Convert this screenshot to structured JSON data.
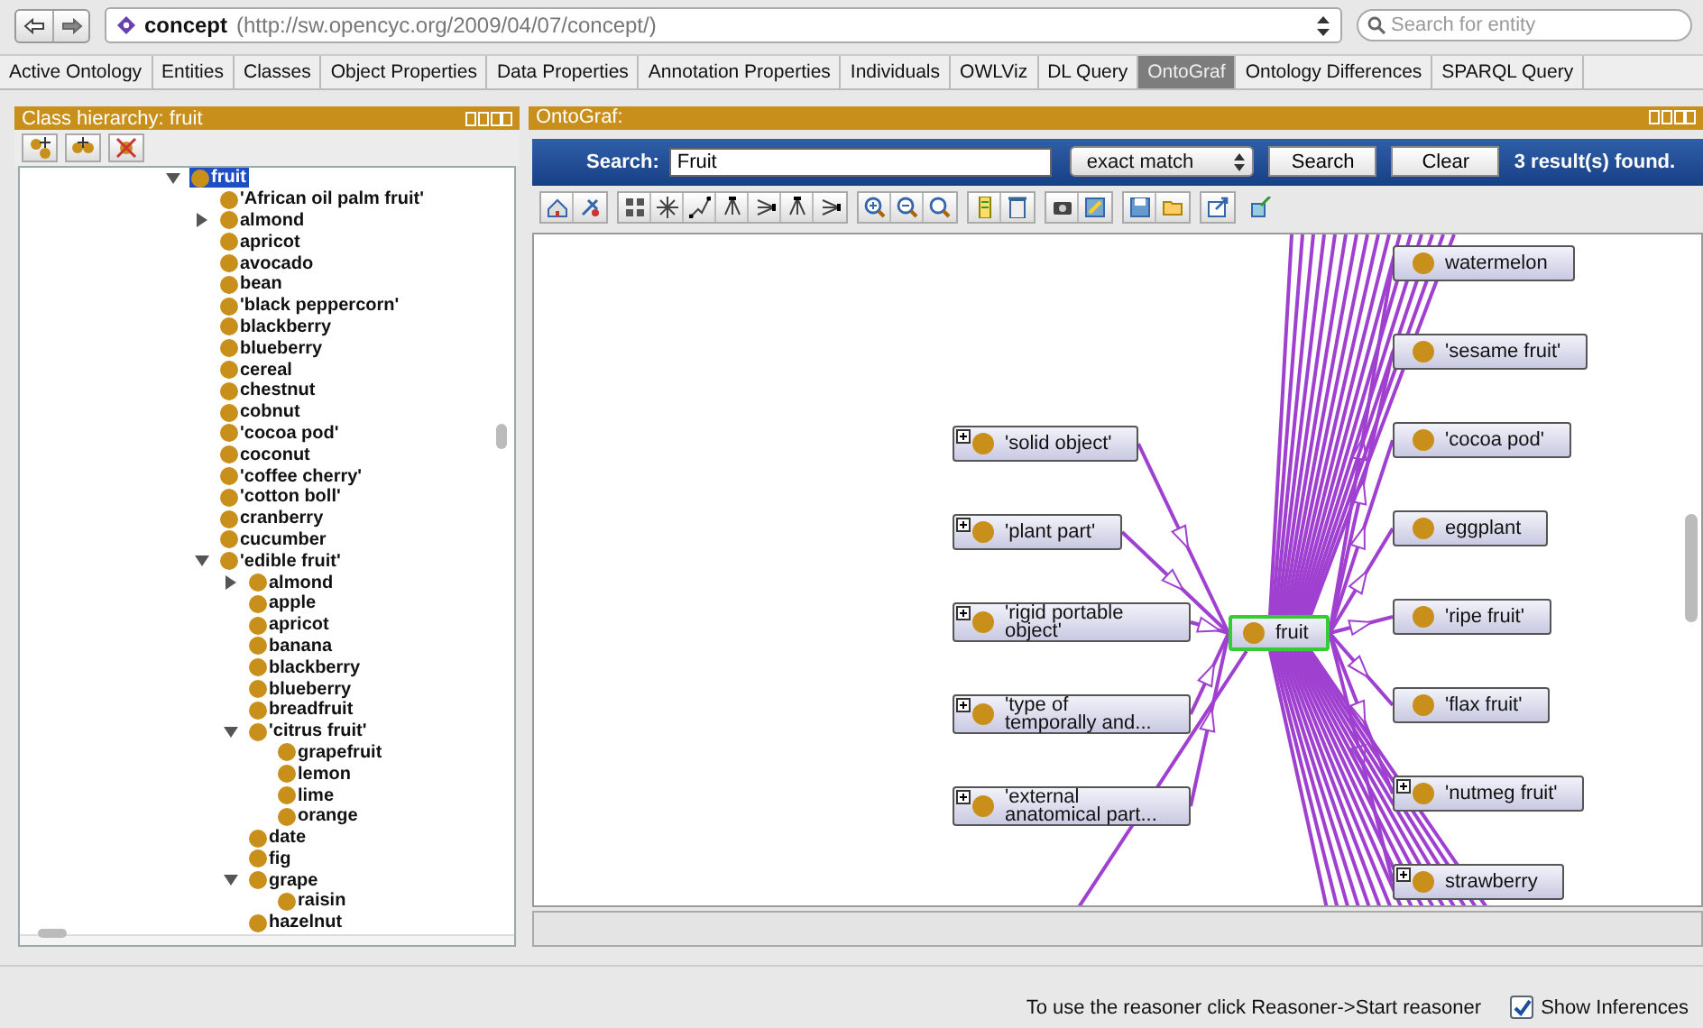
{
  "address_bar": {
    "entity": "concept",
    "uri": "(http://sw.opencyc.org/2009/04/07/concept/)",
    "search_placeholder": "Search for entity"
  },
  "tabs": [
    {
      "label": "Active Ontology",
      "selected": false
    },
    {
      "label": "Entities",
      "selected": false
    },
    {
      "label": "Classes",
      "selected": false
    },
    {
      "label": "Object Properties",
      "selected": false
    },
    {
      "label": "Data Properties",
      "selected": false
    },
    {
      "label": "Annotation Properties",
      "selected": false
    },
    {
      "label": "Individuals",
      "selected": false
    },
    {
      "label": "OWLViz",
      "selected": false
    },
    {
      "label": "DL Query",
      "selected": false
    },
    {
      "label": "OntoGraf",
      "selected": true
    },
    {
      "label": "Ontology Differences",
      "selected": false
    },
    {
      "label": "SPARQL Query",
      "selected": false
    }
  ],
  "class_hierarchy": {
    "title": "Class hierarchy: fruit",
    "tree": [
      {
        "label": "fruit",
        "expanded": true,
        "selected": true,
        "children": [
          {
            "label": "'African oil palm fruit'",
            "selected": false
          },
          {
            "label": "almond",
            "expanded": false,
            "selected": false
          },
          {
            "label": "apricot",
            "selected": false
          },
          {
            "label": "avocado",
            "selected": false
          },
          {
            "label": "bean",
            "selected": false
          },
          {
            "label": "'black peppercorn'",
            "selected": false
          },
          {
            "label": "blackberry",
            "selected": false
          },
          {
            "label": "blueberry",
            "selected": false
          },
          {
            "label": "cereal",
            "selected": false
          },
          {
            "label": "chestnut",
            "selected": false
          },
          {
            "label": "cobnut",
            "selected": false
          },
          {
            "label": "'cocoa pod'",
            "selected": false
          },
          {
            "label": "coconut",
            "selected": false
          },
          {
            "label": "'coffee cherry'",
            "selected": false
          },
          {
            "label": "'cotton boll'",
            "selected": false
          },
          {
            "label": "cranberry",
            "selected": false
          },
          {
            "label": "cucumber",
            "selected": false
          },
          {
            "label": "'edible fruit'",
            "expanded": true,
            "selected": false,
            "children": [
              {
                "label": "almond",
                "expanded": false,
                "selected": false
              },
              {
                "label": "apple",
                "selected": false
              },
              {
                "label": "apricot",
                "selected": false
              },
              {
                "label": "banana",
                "selected": false
              },
              {
                "label": "blackberry",
                "selected": false
              },
              {
                "label": "blueberry",
                "selected": false
              },
              {
                "label": "breadfruit",
                "selected": false
              },
              {
                "label": "'citrus fruit'",
                "expanded": true,
                "selected": false,
                "children": [
                  {
                    "label": "grapefruit",
                    "selected": false
                  },
                  {
                    "label": "lemon",
                    "selected": false
                  },
                  {
                    "label": "lime",
                    "selected": false
                  },
                  {
                    "label": "orange",
                    "selected": false
                  }
                ]
              },
              {
                "label": "date",
                "selected": false
              },
              {
                "label": "fig",
                "selected": false
              },
              {
                "label": "grape",
                "expanded": true,
                "selected": false,
                "children": [
                  {
                    "label": "raisin",
                    "selected": false
                  }
                ]
              },
              {
                "label": "hazelnut",
                "selected": false
              }
            ]
          }
        ]
      }
    ]
  },
  "ontograf": {
    "title": "OntoGraf:",
    "search_label": "Search:",
    "search_value": "Fruit",
    "match_mode": "exact match",
    "search_button": "Search",
    "clear_button": "Clear",
    "result": "3 result(s) found.",
    "nodes": [
      {
        "label": "'solid object'",
        "kind": "parent",
        "expandable": true
      },
      {
        "label": "'plant part'",
        "kind": "parent",
        "expandable": true
      },
      {
        "label": "'rigid portable object'",
        "kind": "parent",
        "expandable": true
      },
      {
        "label": "'type of temporally and...",
        "kind": "parent",
        "expandable": true
      },
      {
        "label": "'external anatomical part...",
        "kind": "parent",
        "expandable": true
      },
      {
        "label": "fruit",
        "kind": "focus",
        "expandable": false
      },
      {
        "label": "watermelon",
        "kind": "child",
        "expandable": false
      },
      {
        "label": "'sesame fruit'",
        "kind": "child",
        "expandable": false
      },
      {
        "label": "'cocoa pod'",
        "kind": "child",
        "expandable": false
      },
      {
        "label": "eggplant",
        "kind": "child",
        "expandable": false
      },
      {
        "label": "'ripe fruit'",
        "kind": "child",
        "expandable": false
      },
      {
        "label": "'flax fruit'",
        "kind": "child",
        "expandable": false
      },
      {
        "label": "'nutmeg fruit'",
        "kind": "child",
        "expandable": true
      },
      {
        "label": "strawberry",
        "kind": "child",
        "expandable": true
      }
    ]
  },
  "status_bar": {
    "message": "To use the reasoner click Reasoner->Start reasoner",
    "show_inferences": {
      "label": "Show Inferences",
      "checked": true
    }
  }
}
